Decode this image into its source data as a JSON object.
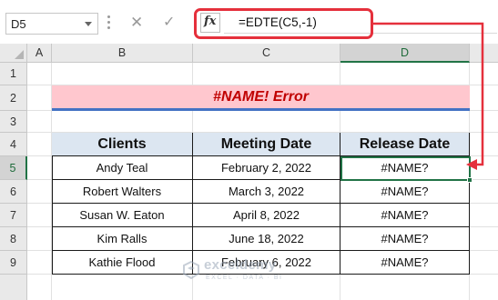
{
  "name_box": {
    "value": "D5"
  },
  "formula_bar": {
    "cancel_icon": "x-icon",
    "enter_icon": "check-icon",
    "fx_label": "fx",
    "formula": "=EDTE(C5,-1)"
  },
  "columns": [
    "A",
    "B",
    "C",
    "D"
  ],
  "rows": [
    "1",
    "2",
    "3",
    "4",
    "5",
    "6",
    "7",
    "8",
    "9"
  ],
  "active_cell": {
    "column": "D",
    "row": "5"
  },
  "title": "#NAME! Error",
  "table": {
    "headers": [
      "Clients",
      "Meeting Date",
      "Release Date"
    ],
    "rows": [
      [
        "Andy Teal",
        "February 2, 2022",
        "#NAME?"
      ],
      [
        "Robert Walters",
        "March 3, 2022",
        "#NAME?"
      ],
      [
        "Susan W. Eaton",
        "April 8, 2022",
        "#NAME?"
      ],
      [
        "Kim Ralls",
        "June 18, 2022",
        "#NAME?"
      ],
      [
        "Kathie Flood",
        "February 6, 2022",
        "#NAME?"
      ]
    ]
  },
  "watermark": {
    "name": "exceldemy",
    "tagline": "EXCEL · DATA · BI"
  },
  "colors": {
    "title_fill": "#ffc7ce",
    "title_text": "#c00000",
    "header_fill": "#dce6f1",
    "highlight_red": "#e5303c",
    "excel_green": "#217346"
  }
}
